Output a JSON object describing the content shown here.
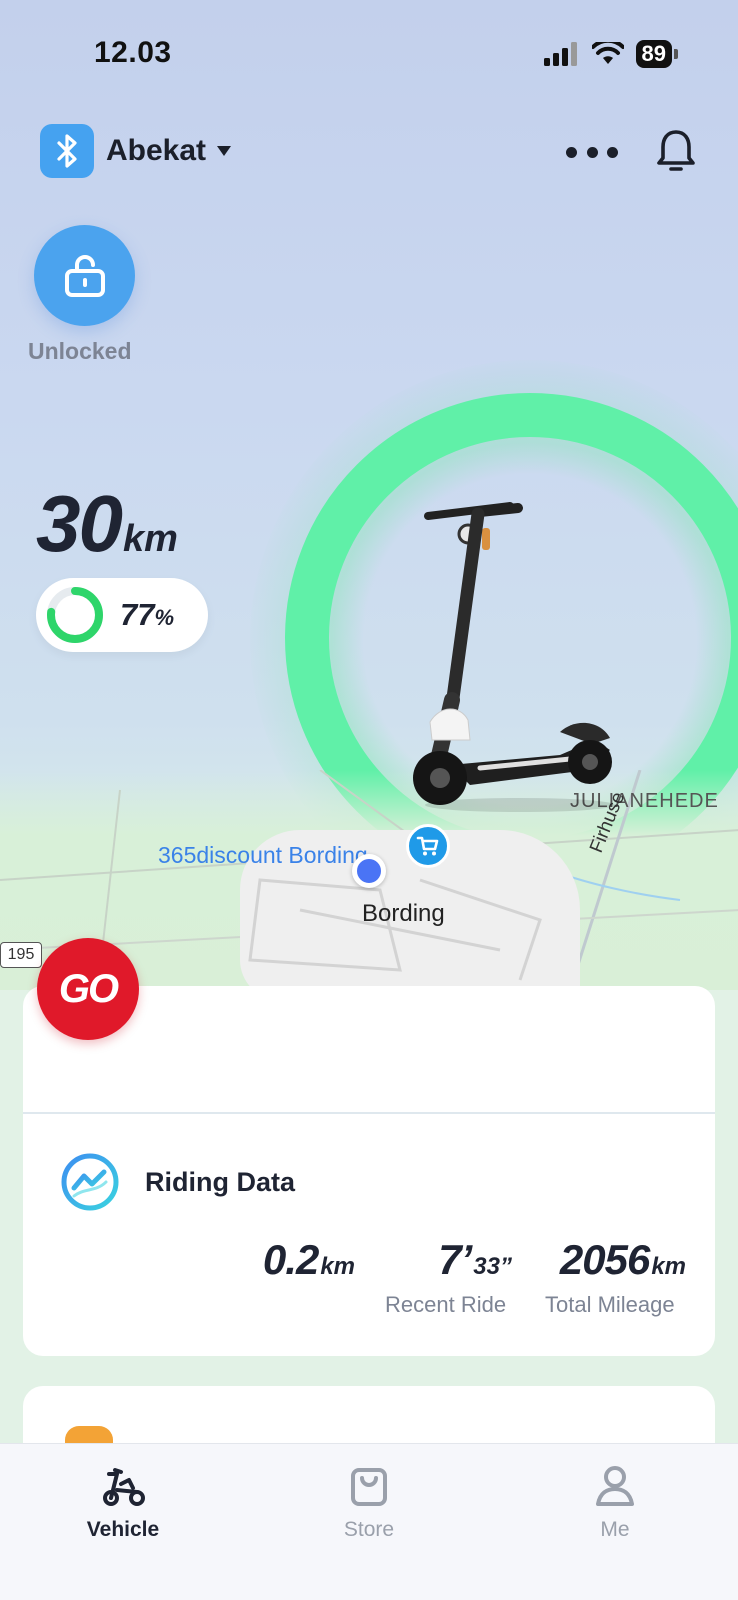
{
  "status_bar": {
    "time": "12.03",
    "battery": "89"
  },
  "header": {
    "device_name": "Abekat"
  },
  "lock": {
    "label": "Unlocked"
  },
  "range": {
    "value": "30",
    "unit": "km"
  },
  "battery": {
    "percent": 0.77,
    "value": "77",
    "unit": "%"
  },
  "map": {
    "shop_label": "365discount Bording",
    "town_label": "Bording",
    "area_label": "JULIANEHEDE",
    "road_label": "Firhuse",
    "road_number": "195"
  },
  "go_button": {
    "label": "GO"
  },
  "riding_data": {
    "title": "Riding Data",
    "stats": [
      {
        "value": "0.2",
        "unit": "km",
        "label": ""
      },
      {
        "value": "7’",
        "unit": "33”",
        "label": "Recent Ride"
      },
      {
        "value": "2056",
        "unit": "km",
        "label": "Total Mileage"
      }
    ]
  },
  "tabs": [
    {
      "label": "Vehicle",
      "icon": "scooter-icon",
      "active": true
    },
    {
      "label": "Store",
      "icon": "bag-icon",
      "active": false
    },
    {
      "label": "Me",
      "icon": "person-icon",
      "active": false
    }
  ],
  "colors": {
    "accent_blue": "#4ba3ee",
    "ring_green": "#60f0a8",
    "go_red": "#e0192a",
    "battery_green": "#2ed56a"
  }
}
